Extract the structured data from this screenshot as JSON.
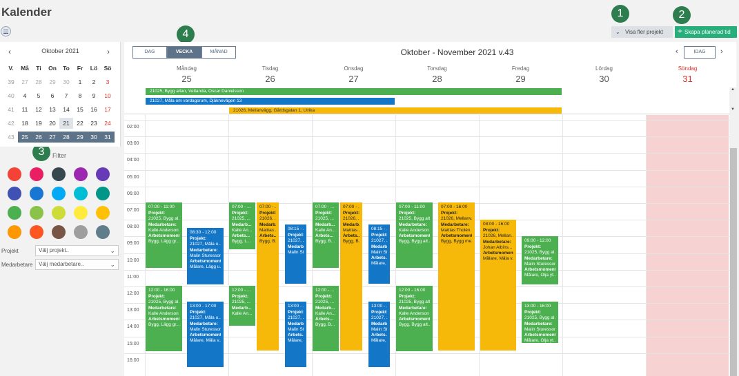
{
  "page": {
    "title": "Kalender"
  },
  "header": {
    "more_projects_label": "Visa fler projekt",
    "create_label": "Skapa planerad tid",
    "badges": [
      "1",
      "2",
      "3",
      "4"
    ]
  },
  "mini_calendar": {
    "title": "Oktober 2021",
    "headers": [
      "V.",
      "Må",
      "Ti",
      "On",
      "To",
      "Fr",
      "Lö",
      "Sö"
    ],
    "weeks": [
      [
        "39",
        "27",
        "28",
        "29",
        "30",
        "1",
        "2",
        "3"
      ],
      [
        "40",
        "4",
        "5",
        "6",
        "7",
        "8",
        "9",
        "10"
      ],
      [
        "41",
        "11",
        "12",
        "13",
        "14",
        "15",
        "16",
        "17"
      ],
      [
        "42",
        "18",
        "19",
        "20",
        "21",
        "22",
        "23",
        "24"
      ],
      [
        "43",
        "25",
        "26",
        "27",
        "28",
        "29",
        "30",
        "31"
      ]
    ]
  },
  "filter": {
    "label": "Filter",
    "colors": [
      "#f44336",
      "#e91e63",
      "#37474f",
      "#9c27b0",
      "#673ab7",
      "#3f51b5",
      "#1976d2",
      "#03a9f4",
      "#00bcd4",
      "#009688",
      "#4caf50",
      "#8bc34a",
      "#cddc39",
      "#ffeb3b",
      "#ffc107",
      "#ff9800",
      "#ff5722",
      "#795548",
      "#9e9e9e",
      "#607d8b"
    ],
    "project_label": "Projekt",
    "project_placeholder": "Välj projekt..",
    "member_label": "Medarbetare",
    "member_placeholder": "Välj medarbetare.."
  },
  "toolbar": {
    "views": [
      "DAG",
      "VECKA",
      "MÅNAD"
    ],
    "active_view": "VECKA",
    "period_title": "Oktober - November 2021 v.43",
    "today_label": "IDAG"
  },
  "days": [
    {
      "name": "Måndag",
      "num": "25"
    },
    {
      "name": "Tisdag",
      "num": "26"
    },
    {
      "name": "Onsdag",
      "num": "27"
    },
    {
      "name": "Torsdag",
      "num": "28"
    },
    {
      "name": "Fredag",
      "num": "29"
    },
    {
      "name": "Lördag",
      "num": "30"
    },
    {
      "name": "Söndag",
      "num": "31"
    }
  ],
  "allday": [
    {
      "text": "21025, Bygg altan, Vetlanda, Oscar Danielsson",
      "color": "#4caf50"
    },
    {
      "text": "21027, Måla om vardagsrum, Djäknevägen 13",
      "color": "#1476c6"
    },
    {
      "text": "21026, Mellanvägg, Gårdsgatan 1, Ulrika",
      "color": "#f6b90a"
    }
  ],
  "hours": [
    "02:00",
    "03:00",
    "04:00",
    "05:00",
    "06:00",
    "07:00",
    "08:00",
    "09:00",
    "10:00",
    "11:00",
    "12:00",
    "13:00",
    "14:00",
    "15:00",
    "16:00"
  ],
  "events": [
    {
      "time": "07:00 - 11:00",
      "lines": [
        "Projekt:",
        "21025, Bygg al...",
        "Medarbetare:",
        "Kalle Anderson",
        "Arbetsmoment:",
        "Bygg, Lägg gr..."
      ]
    },
    {
      "time": "08:30 - 12:00",
      "lines": [
        "Projekt:",
        "21027, Måla o...",
        "Medarbetare:",
        "Malin Sturesson",
        "Arbetsmoment:",
        "Målare, Lägg u..."
      ]
    },
    {
      "time": "12:00 - 16:00",
      "lines": [
        "Projekt:",
        "21025, Bygg al...",
        "Medarbetare:",
        "Kalle Anderson",
        "Arbetsmoment:",
        "Bygg, Lägg gr..."
      ]
    },
    {
      "time": "13:00 - 17:00",
      "lines": [
        "Projekt:",
        "21027, Måla o...",
        "Medarbetare:",
        "Malin Sturesson",
        "Arbetsmoment:",
        "Målare, Måla v..."
      ]
    },
    {
      "time": "07:00 - ...",
      "lines": [
        "Projekt:",
        "21025, ...",
        "Medarb...",
        "Kalle An...",
        "Arbets...",
        "Bygg, L..."
      ]
    },
    {
      "time": "07:00 - ...",
      "lines": [
        "Projekt:",
        "21026, ...",
        "Medarb...",
        "Mattias ...",
        "Arbets...",
        "Bygg, B..."
      ]
    },
    {
      "time": "12:00 - ...",
      "lines": [
        "Projekt:",
        "21025, ...",
        "Medarb...",
        "Kalle An..."
      ]
    },
    {
      "time": "08:15 - ...",
      "lines": [
        "Projekt:",
        "21027, ...",
        "Medarb...",
        "Malin St..."
      ]
    },
    {
      "time": "13:00 - ...",
      "lines": [
        "Projekt:",
        "21027, ...",
        "Medarb...",
        "Malin St...",
        "Arbets...",
        "Målare, ..."
      ]
    },
    {
      "time": "07:00 - ...",
      "lines": [
        "Projekt:",
        "21025, ...",
        "Medarb...",
        "Kalle An...",
        "Arbets...",
        "Bygg, B..."
      ]
    },
    {
      "time": "07:00 - ...",
      "lines": [
        "Projekt:",
        "21026, ...",
        "Medarb...",
        "Mattias ...",
        "Arbets...",
        "Bygg, B..."
      ]
    },
    {
      "time": "12:00 - ...",
      "lines": [
        "Projekt:",
        "21025, ...",
        "Medarb...",
        "Kalle An...",
        "Arbets...",
        "Bygg, B..."
      ]
    },
    {
      "time": "08:15 - ...",
      "lines": [
        "Projekt:",
        "21027, ...",
        "Medarb...",
        "Malin St...",
        "Arbets...",
        "Målare, ..."
      ]
    },
    {
      "time": "13:00 - ...",
      "lines": [
        "Projekt:",
        "21027, ...",
        "Medarb...",
        "Malin St...",
        "Arbets...",
        "Målare, ..."
      ]
    },
    {
      "time": "07:00 - 11:00",
      "lines": [
        "Projekt:",
        "21025, Bygg alt...",
        "Medarbetare:",
        "Kalle Anderson",
        "Arbetsmoment:",
        "Bygg, Bygg alt..."
      ]
    },
    {
      "time": "07:00 - 16:00",
      "lines": [
        "Projekt:",
        "21026, Mellanv...",
        "Medarbetare:",
        "Mattias Tholén",
        "Arbetsmoment:",
        "Bygg, Bygg me..."
      ]
    },
    {
      "time": "12:00 - 16:00",
      "lines": [
        "Projekt:",
        "21025, Bygg alt...",
        "Medarbetare:",
        "Kalle Anderson",
        "Arbetsmoment:",
        "Bygg, Bygg alt..."
      ]
    },
    {
      "time": "08:00 - 16:00",
      "lines": [
        "Projekt:",
        "21026, Mellan...",
        "Medarbetare:",
        "Johan Albins...",
        "Arbetsmoment:",
        "Målare, Måla v..."
      ]
    },
    {
      "time": "09:00 - 12:00",
      "lines": [
        "Projekt:",
        "21025, Bygg al...",
        "Medarbetare:",
        "Malin Sturesson",
        "Arbetsmoment:",
        "Målare, Olja yt..."
      ]
    },
    {
      "time": "13:00 - 16:00",
      "lines": [
        "Projekt:",
        "21025, Bygg al...",
        "Medarbetare:",
        "Malin Sturesson",
        "Arbetsmoment:",
        "Målare, Olja yt..."
      ]
    }
  ]
}
